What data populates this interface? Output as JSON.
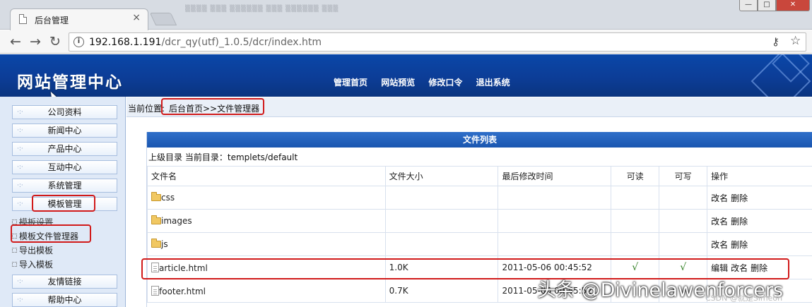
{
  "browser": {
    "tab_title": "后台管理",
    "tab_close": "×",
    "ghost_tabs": "▒▒▒▒ ▒▒▒ ▒▒▒▒▒▒ ▒▒▒ ▒▒▒▒▒▒ ▒▒▒",
    "url_host": "192.168.1.191",
    "url_path": "/dcr_qy(utf)_1.0.5/dcr/index.htm",
    "back_glyph": "←",
    "forward_glyph": "→",
    "reload_glyph": "↻",
    "info_glyph": "i",
    "key_glyph": "⚷",
    "star_glyph": "☆",
    "min_glyph": "—",
    "max_glyph": "□",
    "close_glyph": "✕"
  },
  "header": {
    "logo": "网站管理中心",
    "menu": [
      "管理首页",
      "网站预览",
      "修改口令",
      "退出系统"
    ]
  },
  "sidebar": {
    "buttons": [
      {
        "label": "公司资料"
      },
      {
        "label": "新闻中心"
      },
      {
        "label": "产品中心"
      },
      {
        "label": "互动中心"
      },
      {
        "label": "系统管理"
      },
      {
        "label": "模板管理"
      },
      {
        "label": "友情链接"
      },
      {
        "label": "帮助中心"
      }
    ],
    "subitems": [
      {
        "label": "模板设置"
      },
      {
        "label": "模板文件管理器"
      },
      {
        "label": "导出模板"
      },
      {
        "label": "导入模板"
      }
    ]
  },
  "breadcrumb": {
    "label": "当前位置:",
    "path": "后台首页>>文件管理器"
  },
  "files": {
    "title": "文件列表",
    "up_dir": "上级目录",
    "current_dir_label": "当前目录：",
    "current_dir": "templets/default",
    "columns": [
      "文件名",
      "文件大小",
      "最后修改时间",
      "可读",
      "可写",
      "操作"
    ],
    "rows": [
      {
        "name": "css",
        "size": "",
        "mtime": "",
        "read": "",
        "write": "",
        "actions": [
          "改名",
          "删除"
        ]
      },
      {
        "name": "images",
        "size": "",
        "mtime": "",
        "read": "",
        "write": "",
        "actions": [
          "改名",
          "删除"
        ]
      },
      {
        "name": "js",
        "size": "",
        "mtime": "",
        "read": "",
        "write": "",
        "actions": [
          "改名",
          "删除"
        ]
      },
      {
        "name": "article.html",
        "size": "1.0K",
        "mtime": "2011-05-06 00:45:52",
        "read": "√",
        "write": "√",
        "actions": [
          "编辑",
          "改名",
          "删除"
        ]
      },
      {
        "name": "footer.html",
        "size": "0.7K",
        "mtime": "2011-05-06 00:45:52",
        "read": "",
        "write": "",
        "actions": []
      }
    ]
  },
  "watermark": {
    "main": "头条 @Divinelawenforcers",
    "sub": "CSDN @就是Simeon"
  },
  "colors": {
    "header_blue": "#0c3d97",
    "sidebar_bg": "#dfe9f7",
    "annotation_red": "#d11a1a"
  }
}
